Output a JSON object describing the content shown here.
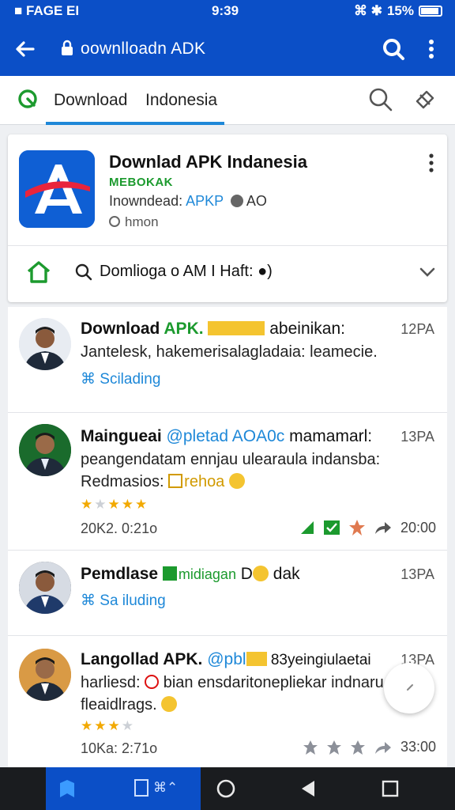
{
  "status": {
    "left": "■ FAGE EI",
    "time": "9:39",
    "right_icons": "⌘ ✱",
    "battery": "15%"
  },
  "browser": {
    "url": "oownlloadn ADK"
  },
  "tabs": {
    "t1": "Download",
    "t2": "Indonesia"
  },
  "app": {
    "name": "Downlad APK Indanesia",
    "developer": "MEBOKAK",
    "meta_prefix": "Inowndead: ",
    "meta_hl": "APKP",
    "meta_suffix": " AO",
    "sub": "hmon",
    "query": "Domlioga o AM I Haft: ●)"
  },
  "feed": [
    {
      "title_b": "Download ",
      "title_g": "APK.",
      "title_rest": " abeinikan:",
      "time": "12PA",
      "line1": "Jantelesk, hakemerisalagladaia: leamecie.",
      "link": "Scilading"
    },
    {
      "title_b": "Maingueai ",
      "title_bl": "@pletad AOA0c",
      "title_rest": " mamamarl:",
      "time": "13PA",
      "line1": "peangendatam ennjau ulearaula indansba:",
      "line2_a": "Redmasios: ",
      "line2_b": "rehoa",
      "date": "20K2. 0:21o",
      "acts_time": "20:00"
    },
    {
      "title_b": "Pemdlase ",
      "title_g": "midiagan",
      "title_rest": " D",
      "title_rest2": " dak",
      "time": "13PA",
      "link": "Sa iluding"
    },
    {
      "title_b": "Langollad APK. ",
      "title_bl": "@pbl",
      "title_rest": " 83yeingiulaetai",
      "time": "13PA",
      "line1": "harliesd: ",
      "line1_b": " bian ensdaritonepliekar indnaru",
      "line2_a": "fleaidlrags.",
      "date": "10Ka: 2:71o",
      "acts_time": "33:00"
    }
  ],
  "nav": {
    "active_label": "⌘⌃"
  }
}
